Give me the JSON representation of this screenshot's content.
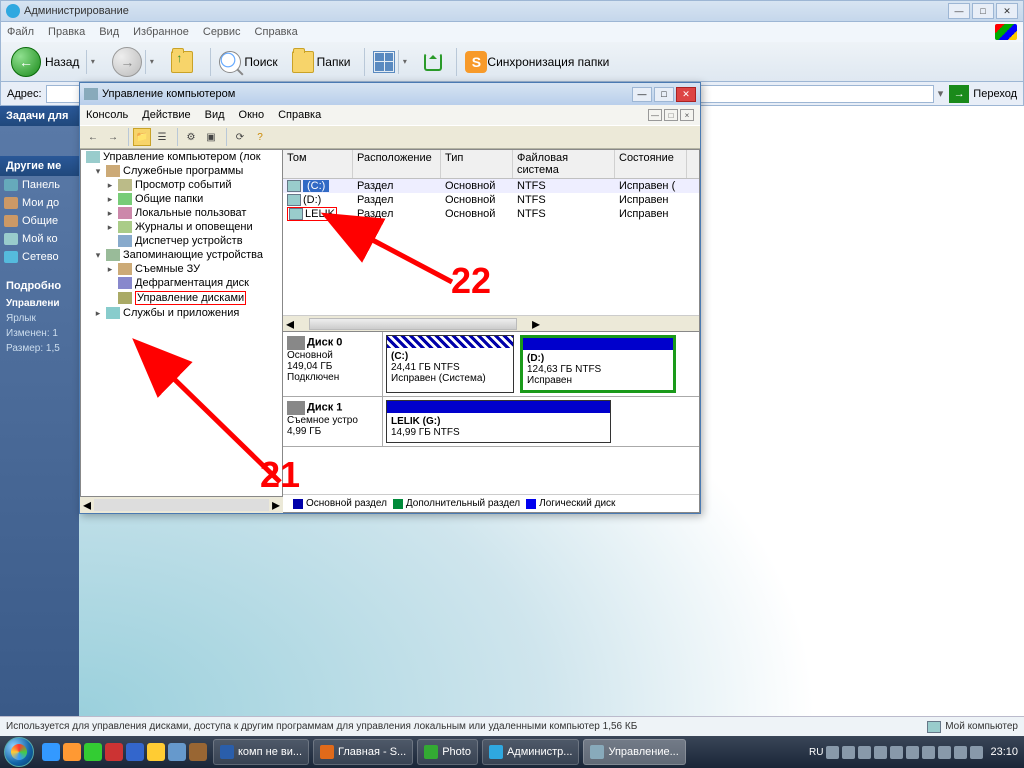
{
  "outer": {
    "title": "Администрирование",
    "menus": [
      "Файл",
      "Правка",
      "Вид",
      "Избранное",
      "Сервис",
      "Справка"
    ],
    "back": "Назад",
    "search": "Поиск",
    "folders": "Папки",
    "sync": "Синхронизация папки",
    "addr_label": "Адрес:",
    "go": "Переход"
  },
  "lp": {
    "tasks": "Задачи для",
    "other": "Другие ме",
    "items": [
      "Панель",
      "Мои до",
      "Общие",
      "Мой ко",
      "Сетево"
    ],
    "details": "Подробно",
    "d1": "Управлени",
    "d2": "Ярлык",
    "d3": "Изменен: 1",
    "d4": "Размер: 1,5"
  },
  "mmc": {
    "title": "Управление компьютером",
    "menus": [
      "Консоль",
      "Действие",
      "Вид",
      "Окно",
      "Справка"
    ],
    "root": "Управление компьютером (лок",
    "t_sys": "Служебные программы",
    "t_ev": "Просмотр событий",
    "t_sh": "Общие папки",
    "t_lu": "Локальные пользоват",
    "t_log": "Журналы и оповещени",
    "t_dm": "Диспетчер устройств",
    "t_sto": "Запоминающие устройства",
    "t_rem": "Съемные ЗУ",
    "t_defr": "Дефрагментация диск",
    "t_disk": "Управление дисками",
    "t_svc": "Службы и приложения",
    "cols": {
      "tom": "Том",
      "ras": "Расположение",
      "tip": "Тип",
      "fs": "Файловая система",
      "sos": "Состояние"
    },
    "vols": [
      {
        "name": "(C:)",
        "ras": "Раздел",
        "tip": "Основной",
        "fs": "NTFS",
        "sos": "Исправен ("
      },
      {
        "name": "(D:)",
        "ras": "Раздел",
        "tip": "Основной",
        "fs": "NTFS",
        "sos": "Исправен"
      },
      {
        "name": "LELIK",
        "ras": "Раздел",
        "tip": "Основной",
        "fs": "NTFS",
        "sos": "Исправен"
      }
    ],
    "disk0": {
      "title": "Диск 0",
      "type": "Основной",
      "size": "149,04 ГБ",
      "state": "Подключен"
    },
    "pc": {
      "label": "(C:)",
      "line": "24,41 ГБ NTFS",
      "st": "Исправен (Система)"
    },
    "pd": {
      "label": "(D:)",
      "line": "124,63 ГБ NTFS",
      "st": "Исправен"
    },
    "disk1": {
      "title": "Диск 1",
      "type": "Съемное устро",
      "size": "4,99 ГБ"
    },
    "pg": {
      "label": "LELIK  (G:)",
      "line": "14,99 ГБ NTFS"
    },
    "leg": {
      "a": "Основной раздел",
      "b": "Дополнительный раздел",
      "c": "Логический диск"
    }
  },
  "status": {
    "text": "Используется для управления дисками, доступа к другим программам для управления локальным или удаленными компьютер 1,56 КБ",
    "mycomp": "Мой компьютер"
  },
  "taskbar": {
    "btns": [
      "комп не ви...",
      "Главная - S...",
      "Photo",
      "Администр...",
      "Управление..."
    ],
    "lang": "RU",
    "time": "23:10"
  },
  "ann": {
    "a": "21",
    "b": "22"
  }
}
